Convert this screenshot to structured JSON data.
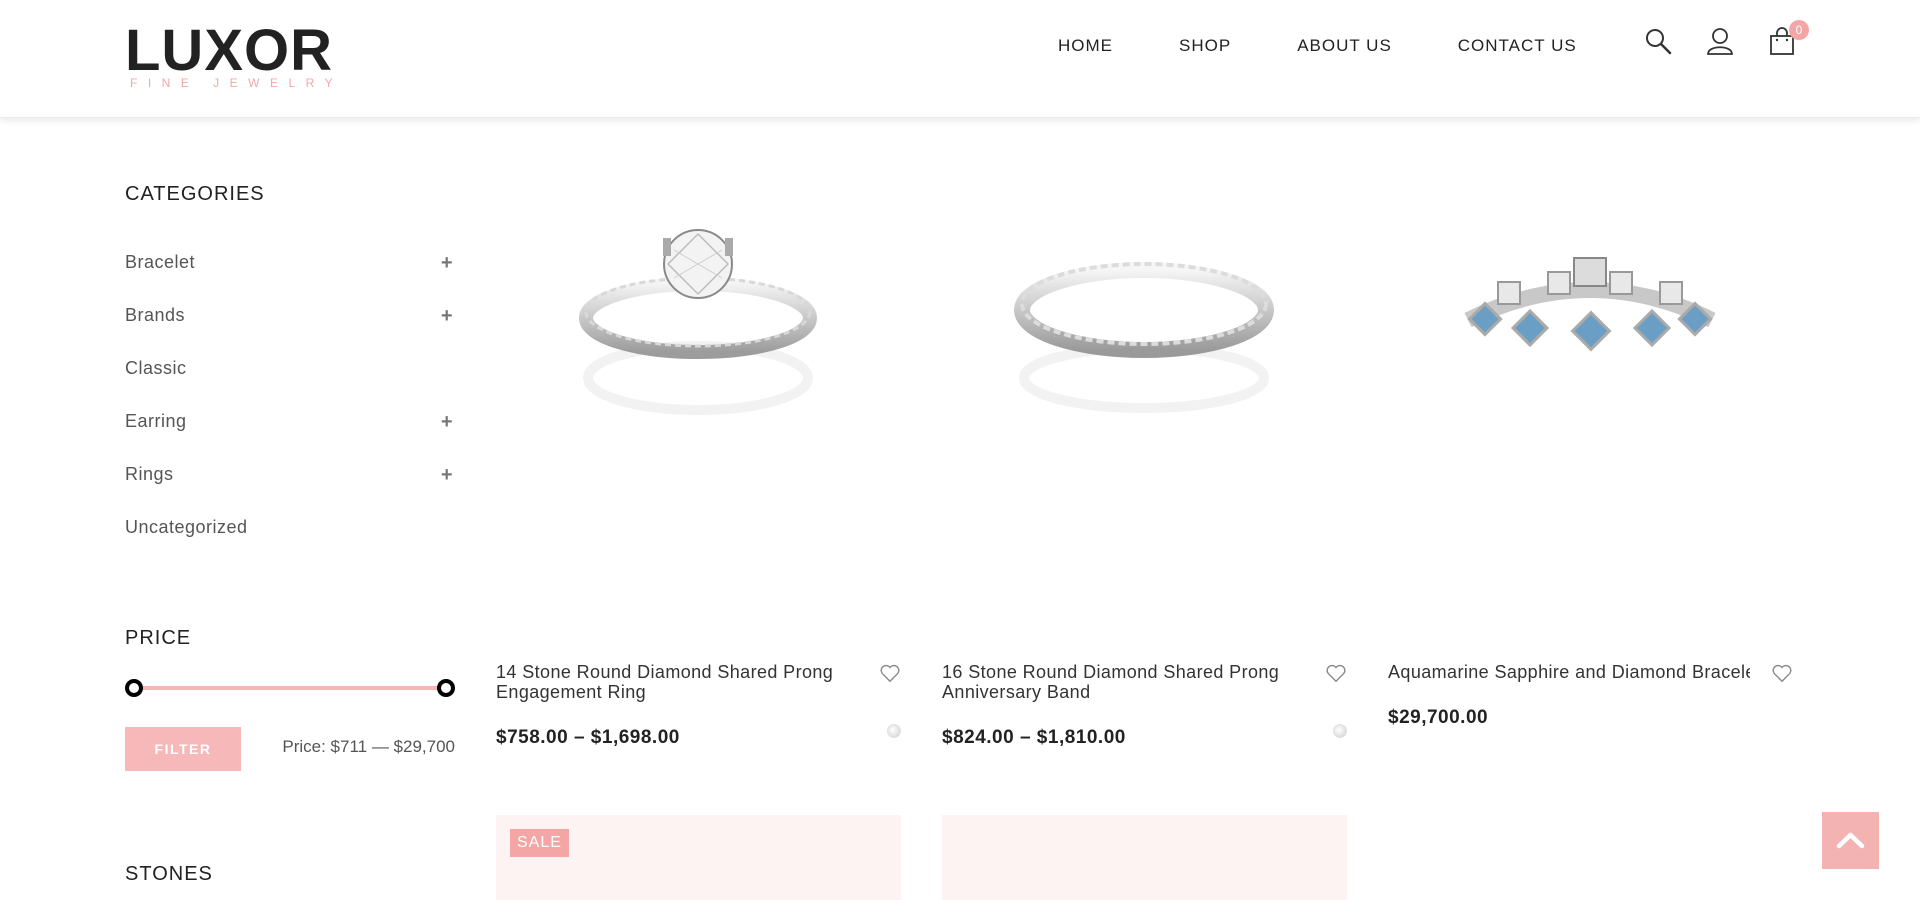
{
  "brand": {
    "name": "LUXOR",
    "tagline": "FINE JEWELRY"
  },
  "nav": {
    "items": [
      "HOME",
      "SHOP",
      "ABOUT US",
      "CONTACT US"
    ],
    "cart_count": "0"
  },
  "sidebar": {
    "categories_title": "CATEGORIES",
    "categories": [
      {
        "label": "Bracelet",
        "expandable": true
      },
      {
        "label": "Brands",
        "expandable": true
      },
      {
        "label": "Classic",
        "expandable": false
      },
      {
        "label": "Earring",
        "expandable": true
      },
      {
        "label": "Rings",
        "expandable": true
      },
      {
        "label": "Uncategorized",
        "expandable": false
      }
    ],
    "price_title": "PRICE",
    "filter_label": "FILTER",
    "price_range": "Price: $711 — $29,700",
    "stones_title": "STONES"
  },
  "products": [
    {
      "name": "14 Stone Round Diamond Shared Prong Engagement Ring",
      "price": "$758.00 – $1,698.00"
    },
    {
      "name": "16 Stone Round Diamond Shared Prong Anniversary Band",
      "price": "$824.00 – $1,810.00"
    },
    {
      "name": "Aquamarine Sapphire and Diamond Bracelet",
      "price": "$29,700.00"
    }
  ],
  "badges": {
    "sale": "SALE"
  },
  "colors": {
    "accent": "#f4a6a6",
    "accent_light": "#fdf3f3",
    "text": "#333333"
  }
}
